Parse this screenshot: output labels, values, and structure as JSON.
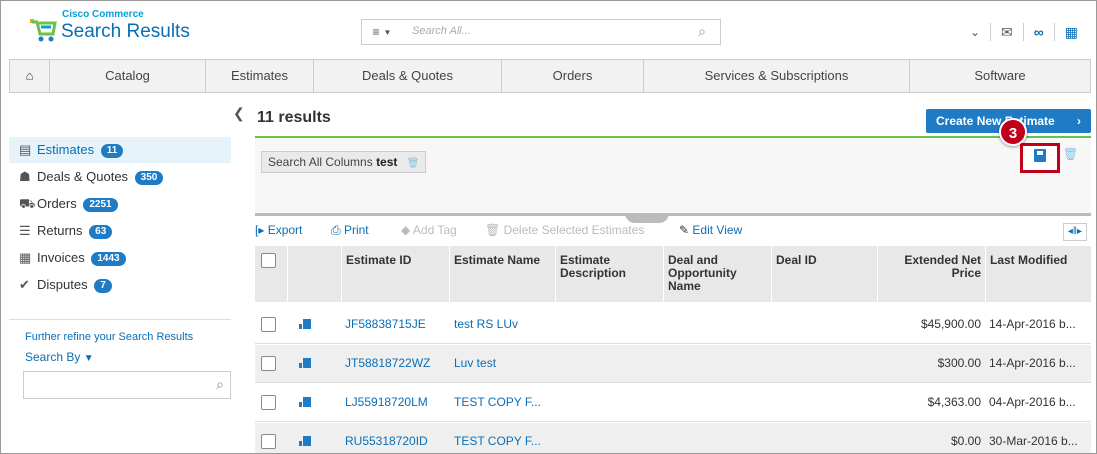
{
  "header": {
    "brand_small": "Cisco Commerce",
    "brand_title": "Search Results",
    "search_placeholder": "Search All...",
    "menu_glyph": "≡",
    "caret_glyph": "▼",
    "mag_glyph": "⌕",
    "icons": {
      "chevron": "⌄",
      "mail": "✉",
      "link": "∞",
      "grid": "▦"
    }
  },
  "nav": {
    "home_glyph": "⌂",
    "items": [
      "Catalog",
      "Estimates",
      "Deals & Quotes",
      "Orders",
      "Services & Subscriptions",
      "Software"
    ]
  },
  "sidebar": {
    "collapse_glyph": "❮",
    "categories": [
      {
        "label": "Estimates",
        "count": "11",
        "icon": "▤"
      },
      {
        "label": "Deals & Quotes",
        "count": "350",
        "icon": "☗"
      },
      {
        "label": "Orders",
        "count": "2251",
        "icon": "⛟"
      },
      {
        "label": "Returns",
        "count": "63",
        "icon": "☰"
      },
      {
        "label": "Invoices",
        "count": "1443",
        "icon": "▦"
      },
      {
        "label": "Disputes",
        "count": "7",
        "icon": "✔"
      }
    ],
    "refine_label": "Further refine your Search Results",
    "search_by_label": "Search By",
    "search_by_caret": "▼",
    "mag_glyph": "⌕"
  },
  "main": {
    "results_label": "11 results",
    "create_button": "Create New Estimate",
    "create_arrow": "›",
    "filter_chip_prefix": "Search All Columns",
    "filter_chip_value": "test",
    "trash_glyph": "🗑",
    "step_number": "3",
    "toolbar": {
      "export": "Export",
      "print": "Print",
      "add_tag": "Add Tag",
      "delete_selected": "Delete Selected Estimates",
      "edit_view": "Edit View",
      "export_glyph": "[▸",
      "print_glyph": "⎙",
      "tag_glyph": "◆",
      "edit_glyph": "✎",
      "columns_glyph": "◂‖▸"
    },
    "table": {
      "columns": [
        "Estimate ID",
        "Estimate Name",
        "Estimate Description",
        "Deal and Opportunity Name",
        "Deal ID",
        "Extended Net Price",
        "Last Modified"
      ],
      "rows": [
        {
          "id": "JF58838715JE",
          "name": "test RS LUv",
          "price": "$45,900.00",
          "modified": "14-Apr-2016 b..."
        },
        {
          "id": "JT58818722WZ",
          "name": "Luv test",
          "price": "$300.00",
          "modified": "14-Apr-2016 b..."
        },
        {
          "id": "LJ55918720LM",
          "name": "TEST COPY F...",
          "price": "$4,363.00",
          "modified": "04-Apr-2016 b..."
        },
        {
          "id": "RU55318720ID",
          "name": "TEST COPY F...",
          "price": "$0.00",
          "modified": "30-Mar-2016 b..."
        }
      ]
    }
  },
  "colors": {
    "accent_blue": "#1e7bc4",
    "link_blue": "#0a6eb4",
    "green_bar": "#6cc04a",
    "highlight_red": "#c0001a"
  }
}
